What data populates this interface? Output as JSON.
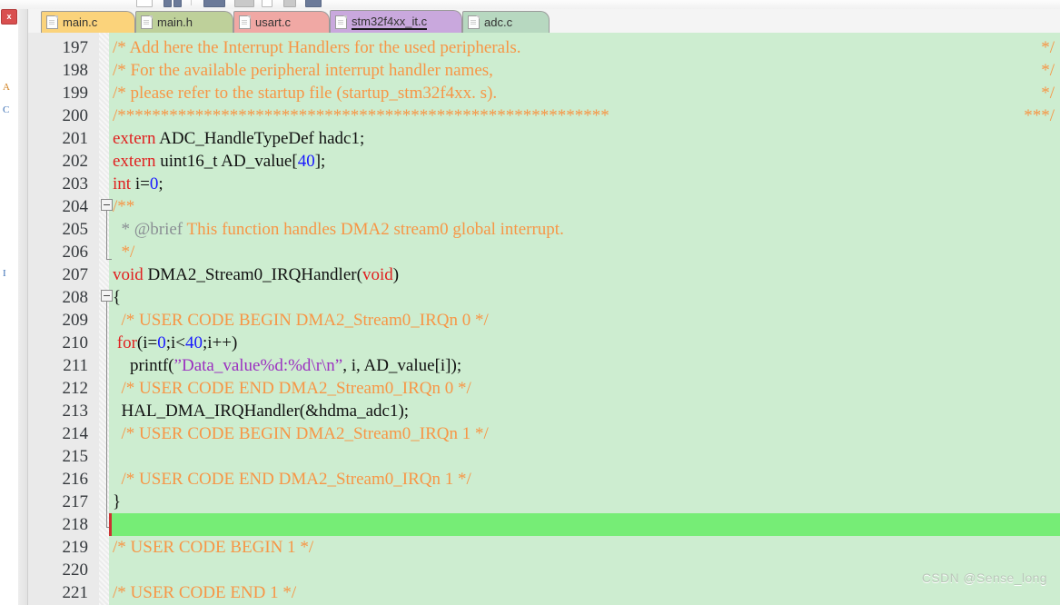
{
  "window": {
    "app": "Keil uVision",
    "watermark": "CSDN @Sense_long"
  },
  "left_rail": {
    "close_label": "x",
    "items": [
      "A",
      "C",
      "I"
    ]
  },
  "tabs": [
    {
      "label": "main.c",
      "color": "#fbd37b",
      "active": false
    },
    {
      "label": "main.h",
      "color": "#bed09a",
      "active": false
    },
    {
      "label": "usart.c",
      "color": "#f0a8a4",
      "active": false
    },
    {
      "label": "stm32f4xx_it.c",
      "color": "#c9a8dd",
      "active": true
    },
    {
      "label": "adc.c",
      "color": "#b7d8c0",
      "active": false
    }
  ],
  "editor": {
    "background": "#cdedd0",
    "current_line_highlight": "#76ed76",
    "caret_color": "#cc3333",
    "first_line_number": 197,
    "current_line": 218,
    "fold_markers": [
      204,
      208
    ],
    "lines": [
      {
        "n": 197,
        "text": "/* Add here the Interrupt Handlers for the used peripherals.",
        "right": "*/"
      },
      {
        "n": 198,
        "text": "/* For the available peripheral interrupt handler names,",
        "right": "*/"
      },
      {
        "n": 199,
        "text": "/* please refer to the startup file (startup_stm32f4xx. s).",
        "right": "*/"
      },
      {
        "n": 200,
        "text": "/*********************************************************",
        "right": "***/"
      },
      {
        "n": 201,
        "text": "extern ADC_HandleTypeDef hadc1;",
        "right": ""
      },
      {
        "n": 202,
        "text": "extern uint16_t AD_value[40];",
        "right": ""
      },
      {
        "n": 203,
        "text": "int i=0;",
        "right": ""
      },
      {
        "n": 204,
        "text": "/**",
        "right": ""
      },
      {
        "n": 205,
        "text": "  * @brief This function handles DMA2 stream0 global interrupt.",
        "right": ""
      },
      {
        "n": 206,
        "text": "  */",
        "right": ""
      },
      {
        "n": 207,
        "text": "void DMA2_Stream0_IRQHandler(void)",
        "right": ""
      },
      {
        "n": 208,
        "text": "{",
        "right": ""
      },
      {
        "n": 209,
        "text": "  /* USER CODE BEGIN DMA2_Stream0_IRQn 0 */",
        "right": ""
      },
      {
        "n": 210,
        "text": " for(i=0;i<40;i++)",
        "right": ""
      },
      {
        "n": 211,
        "text": "    printf(\"Data_value%d:%d\\r\\n\", i, AD_value[i]);",
        "right": ""
      },
      {
        "n": 212,
        "text": "  /* USER CODE END DMA2_Stream0_IRQn 0 */",
        "right": ""
      },
      {
        "n": 213,
        "text": "  HAL_DMA_IRQHandler(&hdma_adc1);",
        "right": ""
      },
      {
        "n": 214,
        "text": "  /* USER CODE BEGIN DMA2_Stream0_IRQn 1 */",
        "right": ""
      },
      {
        "n": 215,
        "text": "",
        "right": ""
      },
      {
        "n": 216,
        "text": "  /* USER CODE END DMA2_Stream0_IRQn 1 */",
        "right": ""
      },
      {
        "n": 217,
        "text": "}",
        "right": ""
      },
      {
        "n": 218,
        "text": "",
        "right": ""
      },
      {
        "n": 219,
        "text": "/* USER CODE BEGIN 1 */",
        "right": ""
      },
      {
        "n": 220,
        "text": "",
        "right": ""
      },
      {
        "n": 221,
        "text": "/* USER CODE END 1 */",
        "right": ""
      }
    ]
  }
}
